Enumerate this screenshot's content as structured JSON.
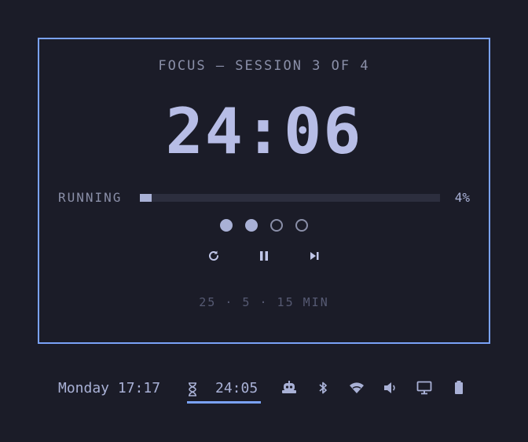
{
  "timer": {
    "session_label": "FOCUS — SESSION 3 OF 4",
    "time": "24:06",
    "status": "RUNNING",
    "progress_percent": 4,
    "progress_text": "4%",
    "sessions_total": 4,
    "sessions_completed": 2,
    "durations": "25 · 5 · 15 MIN"
  },
  "controls": {
    "reset_icon": "refresh-icon",
    "pause_icon": "pause-icon",
    "skip_icon": "skip-next-icon"
  },
  "statusbar": {
    "datetime": "Monday 17:17",
    "timer_time": "24:05",
    "icons": [
      "hourglass-icon",
      "robot-icon",
      "bluetooth-icon",
      "wifi-icon",
      "volume-icon",
      "display-icon",
      "battery-icon"
    ]
  },
  "colors": {
    "accent": "#7aa2f7",
    "background": "#1b1c28",
    "foreground": "#a9b1d6",
    "muted": "#8a8fa8"
  }
}
